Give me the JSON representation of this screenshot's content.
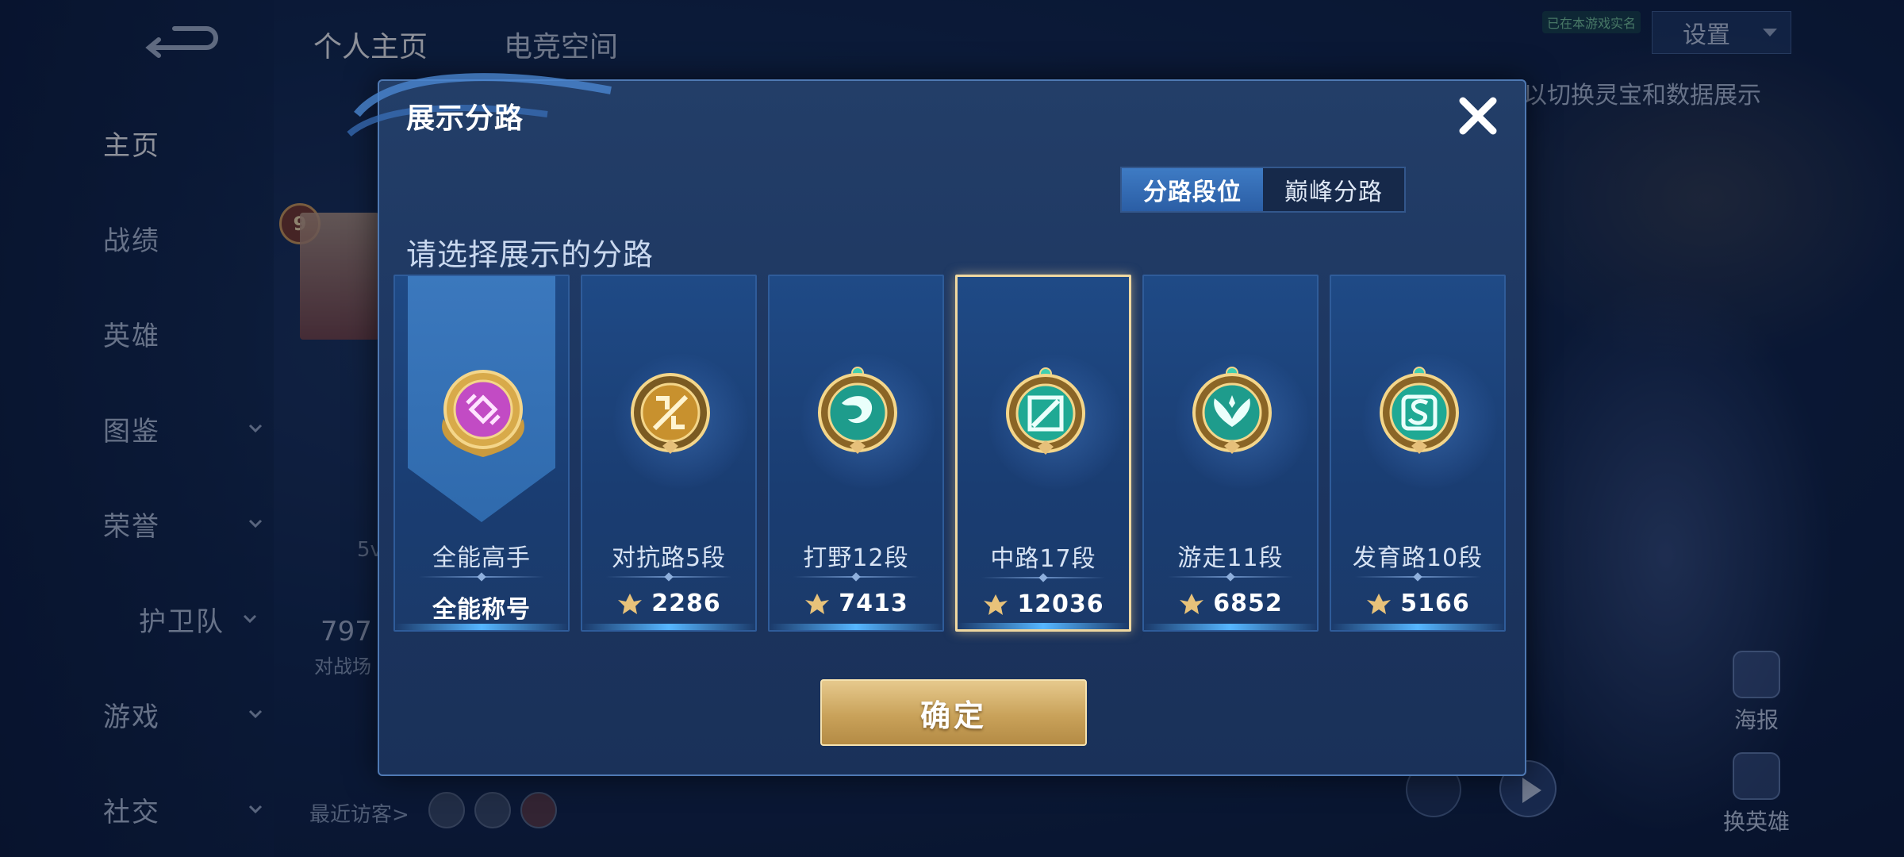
{
  "topbar": {
    "tabs": [
      "个人主页",
      "电竞空间"
    ],
    "settings_label": "设置",
    "sync_badge": "已在本游戏实名",
    "hint": "以切换灵宝和数据展示"
  },
  "sidebar": {
    "items": [
      {
        "label": "主页",
        "chevron": false
      },
      {
        "label": "战绩",
        "chevron": false
      },
      {
        "label": "英雄",
        "chevron": false
      },
      {
        "label": "图鉴",
        "chevron": true
      },
      {
        "label": "荣誉",
        "chevron": true
      },
      {
        "label": "护卫队",
        "chevron": true
      },
      {
        "label": "游戏",
        "chevron": true
      },
      {
        "label": "社交",
        "chevron": true
      }
    ]
  },
  "profile": {
    "level": "9",
    "score_partial": "797",
    "score_sub": "对战场",
    "fivev": "5v",
    "recent_visitors": "最近访客>"
  },
  "right_panel": {
    "poster_label": "海报",
    "switch_hero_label": "换英雄"
  },
  "modal": {
    "title": "展示分路",
    "segments": [
      {
        "label": "分路段位",
        "active": true
      },
      {
        "label": "巅峰分路",
        "active": false
      }
    ],
    "prompt": "请选择展示的分路",
    "cards": [
      {
        "title": "全能高手",
        "value": "全能称号",
        "has_icon": false,
        "selected": false,
        "badge_color": "#c24bc4",
        "icon": "all-round-badge-icon"
      },
      {
        "title": "对抗路5段",
        "value": "2286",
        "has_icon": true,
        "selected": false,
        "badge_color": "#c8912e",
        "icon": "clash-lane-badge-icon"
      },
      {
        "title": "打野12段",
        "value": "7413",
        "has_icon": true,
        "selected": false,
        "badge_color": "#1e9c8c",
        "icon": "jungle-badge-icon"
      },
      {
        "title": "中路17段",
        "value": "12036",
        "has_icon": true,
        "selected": true,
        "badge_color": "#1fa994",
        "icon": "mid-lane-badge-icon"
      },
      {
        "title": "游走11段",
        "value": "6852",
        "has_icon": true,
        "selected": false,
        "badge_color": "#1e9c8c",
        "icon": "roam-badge-icon"
      },
      {
        "title": "发育路10段",
        "value": "5166",
        "has_icon": true,
        "selected": false,
        "badge_color": "#1fa994",
        "icon": "farm-lane-badge-icon"
      }
    ],
    "confirm_label": "确定"
  },
  "colors": {
    "accent_blue": "#3e7bc4",
    "gold": "#c9a25a",
    "selected_border": "#f0d8a0"
  }
}
